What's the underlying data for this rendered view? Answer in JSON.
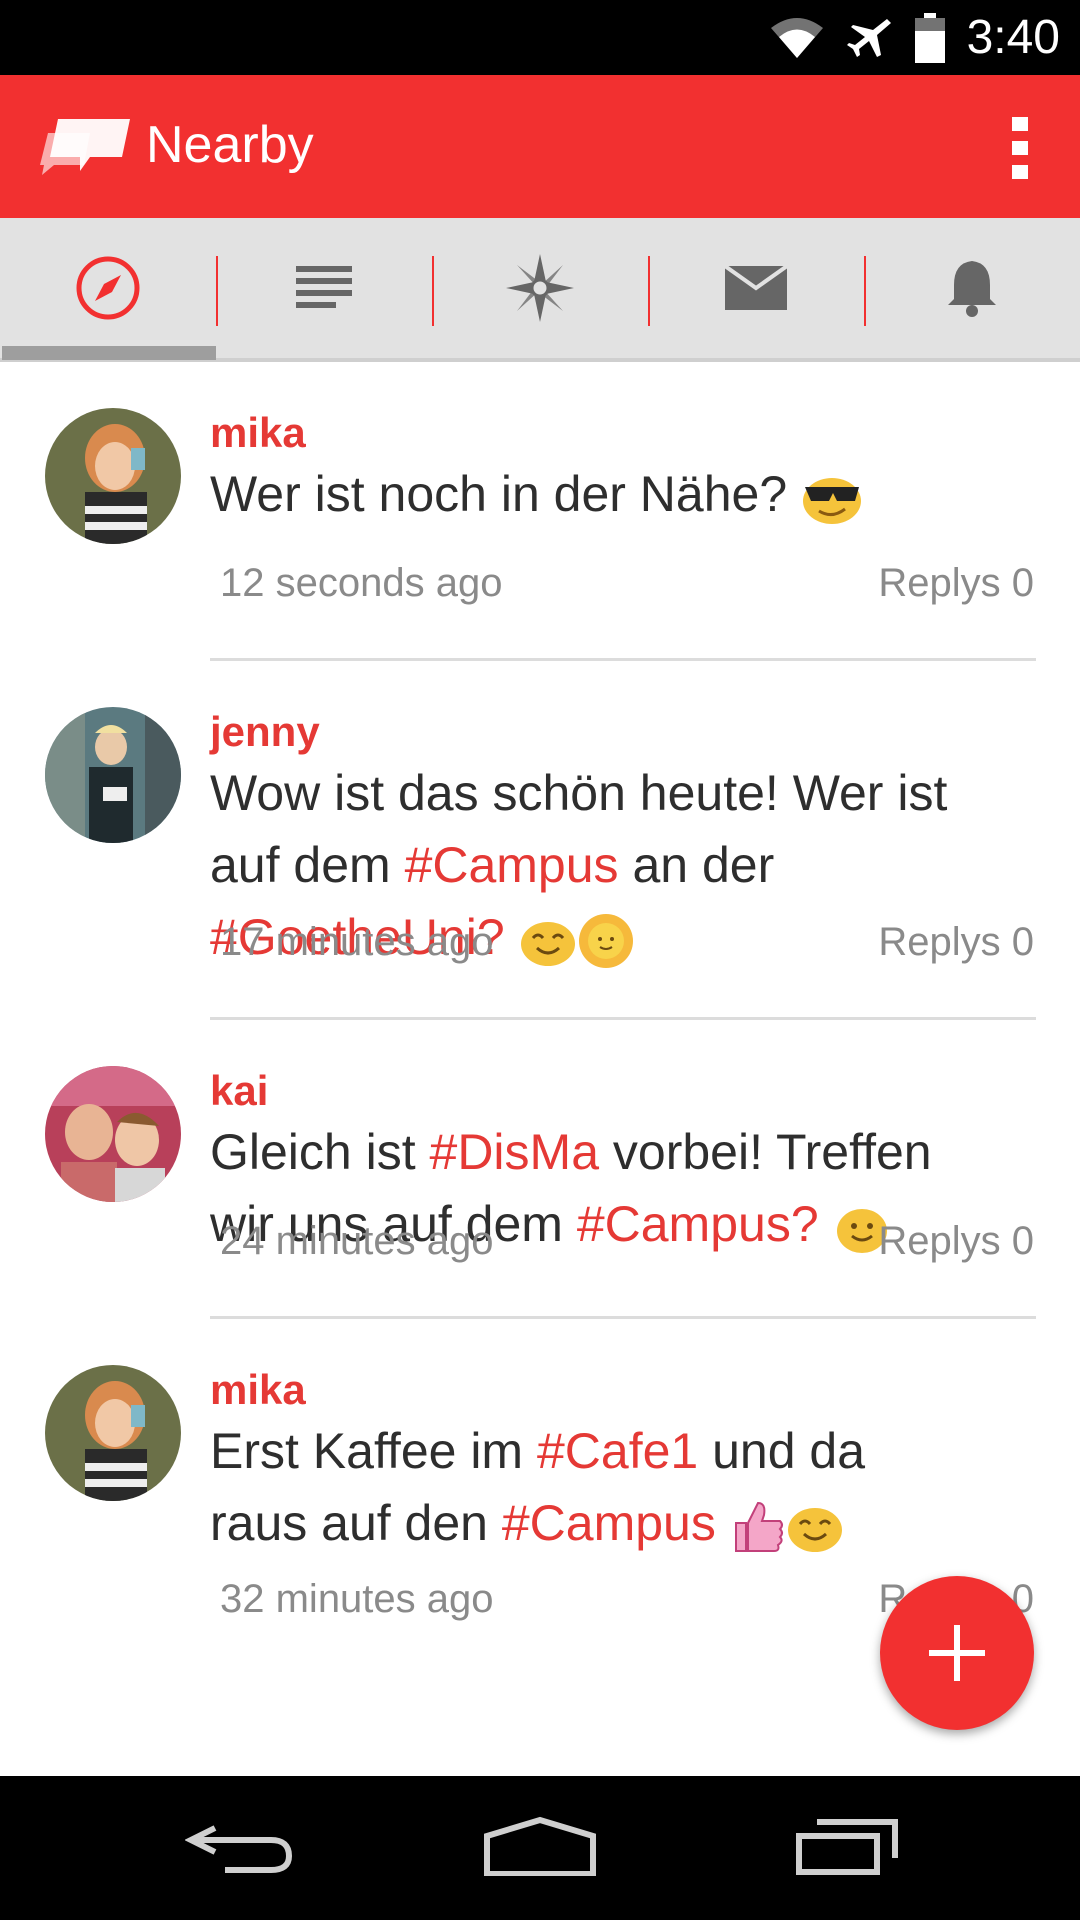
{
  "status_bar": {
    "time": "3:40",
    "icons": [
      "wifi-icon",
      "airplane-icon",
      "battery-icon"
    ]
  },
  "app_bar": {
    "title": "Nearby",
    "logo": "chat-bubble-logo",
    "menu_icon": "overflow-menu-icon"
  },
  "tabs": [
    {
      "icon": "compass-icon",
      "selected": true
    },
    {
      "icon": "list-icon",
      "selected": false
    },
    {
      "icon": "star-compass-icon",
      "selected": false
    },
    {
      "icon": "mail-icon",
      "selected": false
    },
    {
      "icon": "bell-icon",
      "selected": false
    }
  ],
  "posts": [
    {
      "user": "mika",
      "text_parts": [
        "Wer ist noch in der Nähe?"
      ],
      "emojis": [
        "sunglasses-emoji"
      ],
      "time": "12 seconds ago",
      "replies": "Replys 0"
    },
    {
      "user": "jenny",
      "line1": "Wow ist das schön heute! Wer ist",
      "line2_a": "auf dem ",
      "line2_tag": "#Campus",
      "line2_b": " an der",
      "line3_tag": "#GoetheUni?",
      "emojis": [
        "smiling-emoji",
        "sun-emoji"
      ],
      "time": "17 minutes ago",
      "replies": "Replys 0"
    },
    {
      "user": "kai",
      "line1_a": "Gleich ist ",
      "line1_tag": "#DisMa",
      "line1_b": " vorbei! Treffen",
      "line2_a": "wir uns auf dem ",
      "line2_tag": "#Campus?",
      "emojis": [
        "slightly-smiling-emoji"
      ],
      "time": "24 minutes ago",
      "replies": "Replys 0"
    },
    {
      "user": "mika",
      "line1_a": "Erst Kaffee im ",
      "line1_tag": "#Cafe1",
      "line1_b": " und da",
      "line2_a": "raus auf den ",
      "line2_tag": "#Campus",
      "emojis": [
        "thumbs-up-emoji",
        "smiling-emoji"
      ],
      "time": "32 minutes ago",
      "replies": "Replys 0"
    }
  ],
  "colors": {
    "accent": "#f23030",
    "tag": "#e53935",
    "tabbar": "#e2e2e2"
  },
  "nav": [
    "back-icon",
    "home-icon",
    "recents-icon"
  ]
}
